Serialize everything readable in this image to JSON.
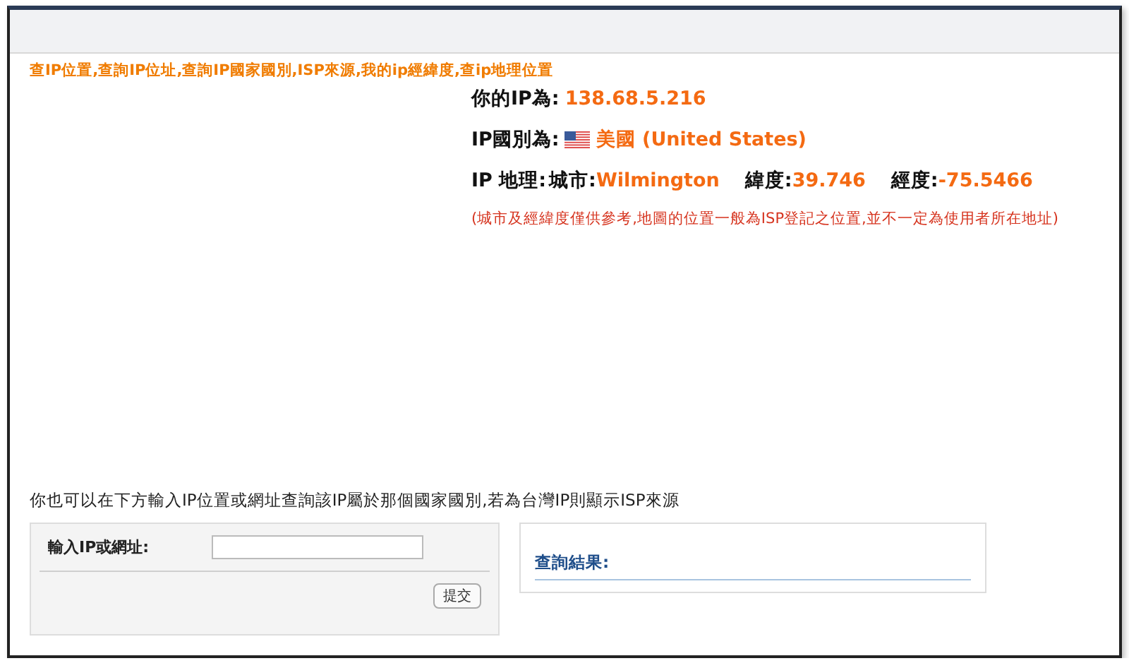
{
  "header_text": "查IP位置,查詢IP位址,查詢IP國家國別,ISP來源,我的ip經緯度,查ip地理位置",
  "ip_info": {
    "ip": {
      "label": "你的IP為:",
      "value": "138.68.5.216"
    },
    "country": {
      "label": "IP國別為:",
      "value": "美國 (United States)"
    },
    "geo": {
      "label": "IP 地理:",
      "city_label": "城市:",
      "city": "Wilmington",
      "lat_label": "緯度:",
      "lat": "39.746",
      "lon_label": "經度:",
      "lon": "-75.5466"
    },
    "note": "(城市及經緯度僅供參考,地圖的位置一般為ISP登記之位置,並不一定為使用者所在地址)"
  },
  "lookup": {
    "intro": "你也可以在下方輸入IP位置或網址查詢該IP屬於那個國家國別,若為台灣IP則顯示ISP來源",
    "input_label": "輸入IP或網址:",
    "submit": "提交"
  },
  "result": {
    "label": "查詢結果:"
  }
}
